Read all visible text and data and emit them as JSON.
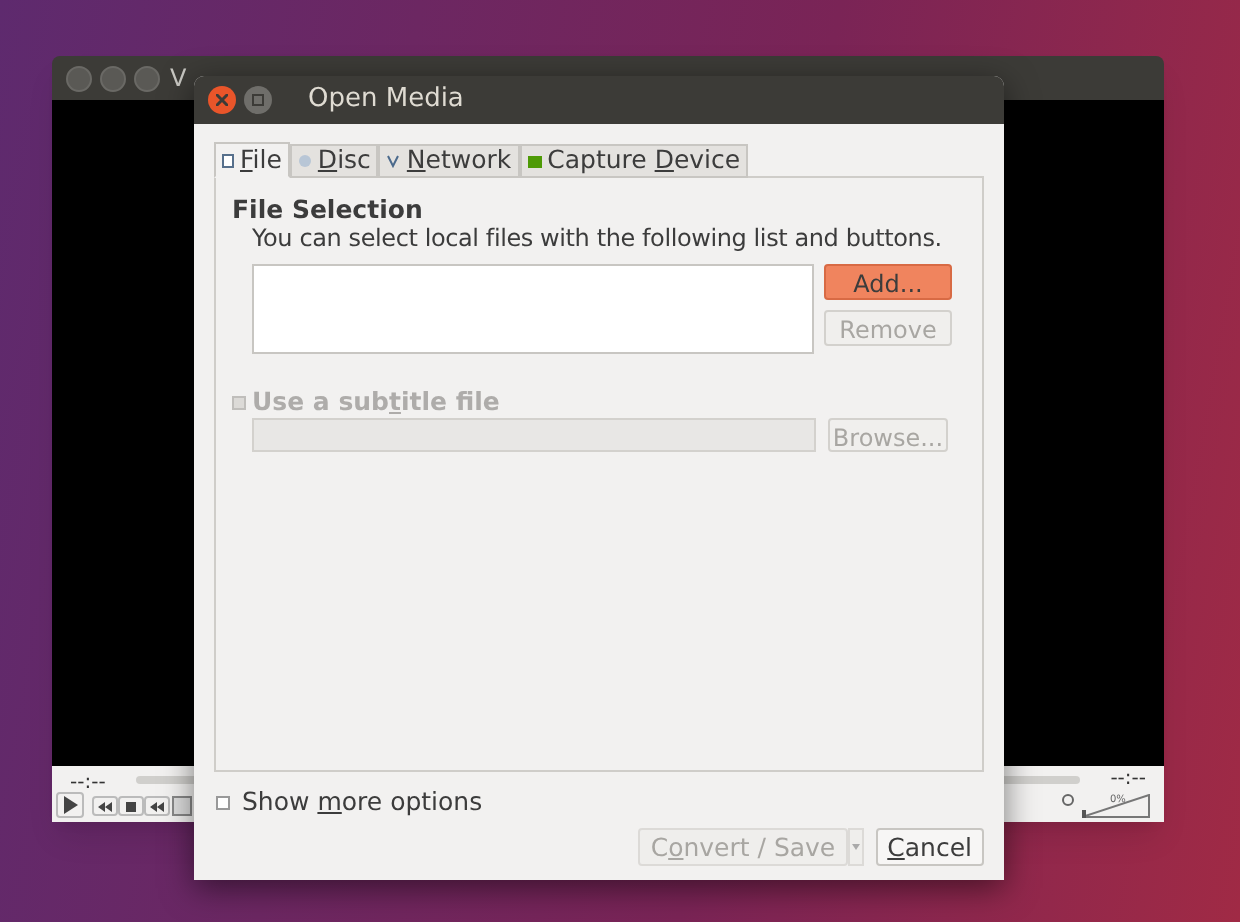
{
  "player": {
    "title": "V",
    "time_elapsed": "--:--",
    "time_total": "--:--",
    "volume": {
      "reading": "0%",
      "level": 0
    }
  },
  "dialog": {
    "title": "Open Media",
    "tabs": [
      {
        "label": {
          "key": "F",
          "post": "ile"
        },
        "selected": true
      },
      {
        "label": {
          "key": "D",
          "post": "isc"
        },
        "selected": false
      },
      {
        "label": {
          "key": "N",
          "post": "etwork"
        },
        "selected": false
      },
      {
        "label": {
          "pre": "Capture ",
          "key": "D",
          "post": "evice"
        },
        "selected": false
      }
    ],
    "file_selection": {
      "heading": "File Selection",
      "description": "You can select local files with the following list and buttons.",
      "buttons": [
        {
          "label": "Add...",
          "default": true,
          "disabled": false
        },
        {
          "label": "Remove",
          "default": false,
          "disabled": true
        }
      ]
    },
    "subtitle": {
      "label": {
        "pre": "Use a sub",
        "key": "t",
        "post": "itle file"
      },
      "checked": false,
      "disabled": true,
      "browse": {
        "label": "Browse...",
        "disabled": true
      }
    },
    "more_options": {
      "label": {
        "pre": "Show ",
        "key": "m",
        "post": "ore options"
      },
      "checked": false
    },
    "buttons": [
      {
        "label": {
          "pre": "C",
          "key": "o",
          "post": "nvert / Save"
        },
        "disabled": true,
        "kind": "split"
      },
      {
        "label": {
          "key": "C",
          "post": "ancel"
        },
        "disabled": false,
        "kind": "plain"
      }
    ]
  }
}
